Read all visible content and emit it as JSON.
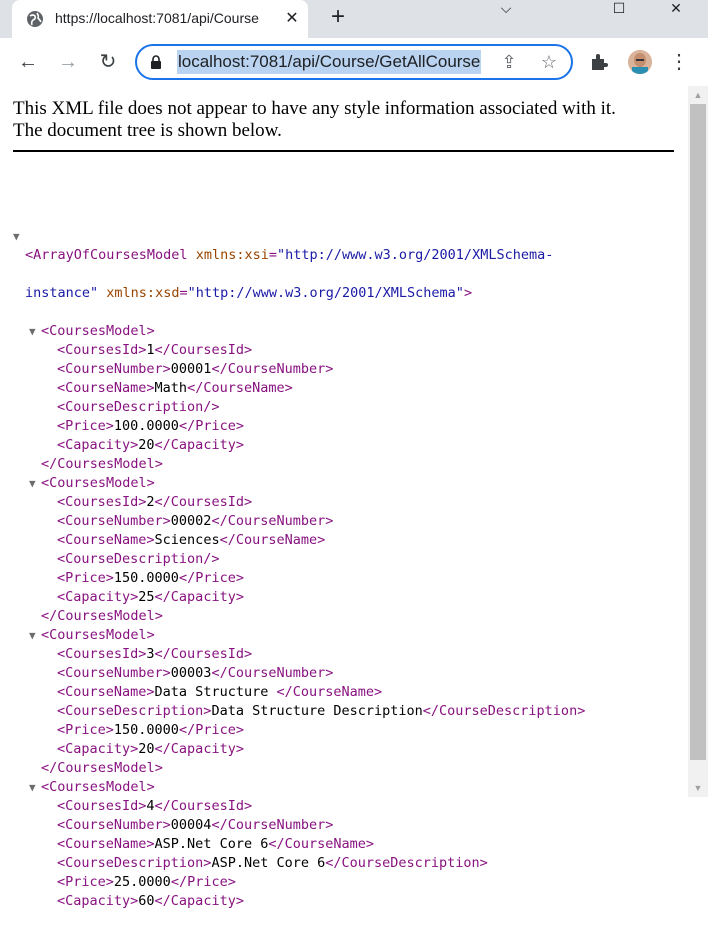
{
  "browser": {
    "tab": {
      "title": "https://localhost:7081/api/Course",
      "close_glyph": "✕",
      "favicon": "globe-icon"
    },
    "new_tab_glyph": "+",
    "window_controls": {
      "minimize": "⌵",
      "maximize": "☐",
      "close": "✕"
    },
    "address_bar": {
      "url": "localhost:7081/api/Course/GetAllCourse"
    },
    "toolbar": {
      "back": "←",
      "forward": "→",
      "reload": "↻",
      "share": "⇪",
      "star": "☆",
      "menu": "⋮"
    },
    "colors": {
      "titlebar_bg": "#dee1e6",
      "omnibox_border": "#1a73e8",
      "url_highlight": "#b9d3f0"
    }
  },
  "xml_viewer": {
    "notice_line1": "This XML file does not appear to have any style information associated with it.",
    "notice_line2": "The document tree is shown below.",
    "colors": {
      "tag": "#881280",
      "attr_name": "#994500",
      "attr_value": "#1a1aa6"
    },
    "root": {
      "open_tag": "<ArrayOfCoursesModel",
      "attr1_name": "xmlns:xsi",
      "attr1_value": "\"http://www.w3.org/2001/XMLSchema-",
      "attr1_value_cont": "instance\"",
      "attr2_name": "xmlns:xsd",
      "attr2_value": "\"http://www.w3.org/2001/XMLSchema\"",
      "open_end": ">"
    },
    "courses": [
      {
        "open": "<CoursesModel>",
        "close": "</CoursesModel>",
        "rows": [
          {
            "open": "<CoursesId>",
            "text": "1",
            "close": "</CoursesId>"
          },
          {
            "open": "<CourseNumber>",
            "text": "00001",
            "close": "</CourseNumber>"
          },
          {
            "open": "<CourseName>",
            "text": "Math",
            "close": "</CourseName>"
          },
          {
            "open": "<CourseDescription/>",
            "text": "",
            "close": ""
          },
          {
            "open": "<Price>",
            "text": "100.0000",
            "close": "</Price>"
          },
          {
            "open": "<Capacity>",
            "text": "20",
            "close": "</Capacity>"
          }
        ]
      },
      {
        "open": "<CoursesModel>",
        "close": "</CoursesModel>",
        "rows": [
          {
            "open": "<CoursesId>",
            "text": "2",
            "close": "</CoursesId>"
          },
          {
            "open": "<CourseNumber>",
            "text": "00002",
            "close": "</CourseNumber>"
          },
          {
            "open": "<CourseName>",
            "text": "Sciences",
            "close": "</CourseName>"
          },
          {
            "open": "<CourseDescription/>",
            "text": "",
            "close": ""
          },
          {
            "open": "<Price>",
            "text": "150.0000",
            "close": "</Price>"
          },
          {
            "open": "<Capacity>",
            "text": "25",
            "close": "</Capacity>"
          }
        ]
      },
      {
        "open": "<CoursesModel>",
        "close": "</CoursesModel>",
        "rows": [
          {
            "open": "<CoursesId>",
            "text": "3",
            "close": "</CoursesId>"
          },
          {
            "open": "<CourseNumber>",
            "text": "00003",
            "close": "</CourseNumber>"
          },
          {
            "open": "<CourseName>",
            "text": "Data Structure ",
            "close": "</CourseName>"
          },
          {
            "open": "<CourseDescription>",
            "text": "Data Structure Description",
            "close": "</CourseDescription>"
          },
          {
            "open": "<Price>",
            "text": "150.0000",
            "close": "</Price>"
          },
          {
            "open": "<Capacity>",
            "text": "20",
            "close": "</Capacity>"
          }
        ]
      },
      {
        "open": "<CoursesModel>",
        "close": "",
        "rows": [
          {
            "open": "<CoursesId>",
            "text": "4",
            "close": "</CoursesId>"
          },
          {
            "open": "<CourseNumber>",
            "text": "00004",
            "close": "</CourseNumber>"
          },
          {
            "open": "<CourseName>",
            "text": "ASP.Net Core 6",
            "close": "</CourseName>"
          },
          {
            "open": "<CourseDescription>",
            "text": "ASP.Net Core 6",
            "close": "</CourseDescription>"
          },
          {
            "open": "<Price>",
            "text": "25.0000",
            "close": "</Price>"
          },
          {
            "open": "<Capacity>",
            "text": "60",
            "close": "</Capacity>"
          }
        ]
      }
    ]
  }
}
